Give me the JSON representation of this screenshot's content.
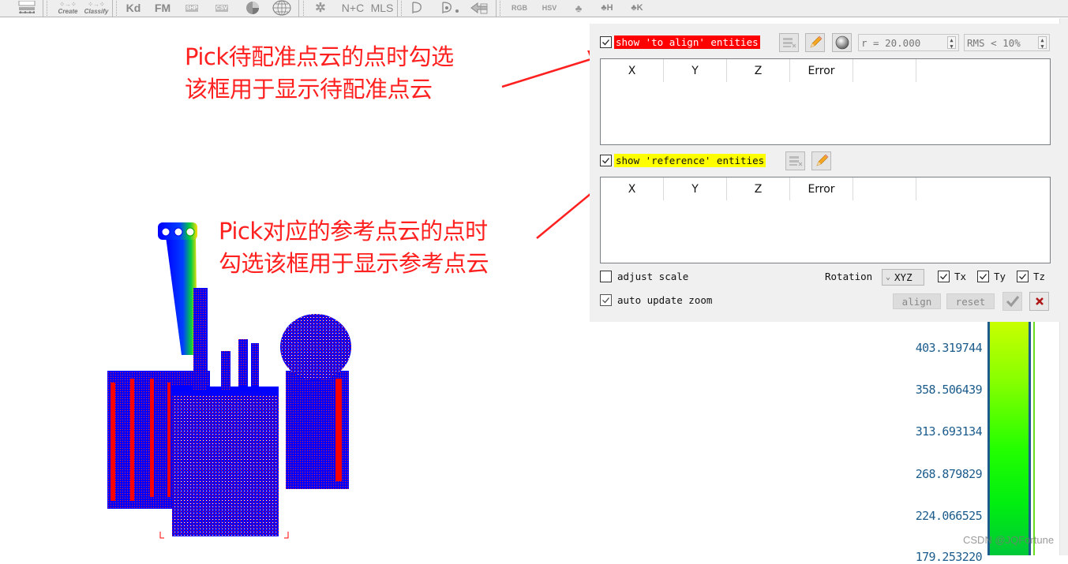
{
  "toolbar": {
    "items": [
      {
        "label": "",
        "icon": "scalar-field-icon"
      },
      {
        "label": "Create",
        "icon": "create-cloud-icon"
      },
      {
        "label": "Classify",
        "icon": "classify-icon"
      },
      {
        "label": "Kd",
        "icon": "kd-tree-icon"
      },
      {
        "label": "FM",
        "icon": "fast-marching-icon"
      },
      {
        "label": "SHP",
        "icon": "shp-file-icon"
      },
      {
        "label": "CSV",
        "icon": "csv-file-icon"
      },
      {
        "label": "",
        "icon": "pie-icon"
      },
      {
        "label": "",
        "icon": "sphere-grid-icon"
      },
      {
        "label": "",
        "icon": "puzzle-icon"
      },
      {
        "label": "N+C",
        "icon": "normals-icon"
      },
      {
        "label": "MLS",
        "icon": "mls-icon"
      },
      {
        "label": "",
        "icon": "lasso-icon"
      },
      {
        "label": "",
        "icon": "point-pick-icon"
      },
      {
        "label": "",
        "icon": "back-arrow-icon"
      },
      {
        "label": "RGB",
        "icon": "rgb-tree-icon"
      },
      {
        "label": "HSV",
        "icon": "hsv-tree-icon"
      },
      {
        "label": "",
        "icon": "tree-icon"
      },
      {
        "label": "H",
        "icon": "h-tree-icon"
      },
      {
        "label": "K",
        "icon": "k-tree-icon"
      }
    ]
  },
  "annotations": {
    "top": {
      "line1": "Pick待配准点云的点时勾选",
      "line2": "该框用于显示待配准点云"
    },
    "middle": {
      "line1": "Pick对应的参考点云的点时",
      "line2": "勾选该框用于显示参考点云"
    },
    "color": "#ff2020"
  },
  "panel": {
    "to_align": {
      "checked": true,
      "label": "show 'to align' entities",
      "highlight": "#ff0000",
      "radius": "r = 20.000",
      "rms": "RMS < 10%",
      "columns": [
        "X",
        "Y",
        "Z",
        "Error",
        ""
      ],
      "rows": []
    },
    "reference": {
      "checked": true,
      "label": "show 'reference' entities",
      "highlight": "#ffff00",
      "columns": [
        "X",
        "Y",
        "Z",
        "Error",
        ""
      ],
      "rows": []
    },
    "adjust_scale": {
      "checked": false,
      "label": "adjust scale"
    },
    "auto_update_zoom": {
      "checked": true,
      "label": "auto update zoom"
    },
    "rotation": {
      "label": "Rotation",
      "value": "XYZ"
    },
    "tx": {
      "checked": true,
      "label": "Tx"
    },
    "ty": {
      "checked": true,
      "label": "Ty"
    },
    "tz": {
      "checked": true,
      "label": "Tz"
    },
    "align_label": "align",
    "reset_label": "reset"
  },
  "scale_bar": {
    "labels": [
      "403.319744",
      "358.506439",
      "313.693134",
      "268.879829",
      "224.066525",
      "179.253220"
    ]
  },
  "watermark": "CSDN @JQFortune"
}
